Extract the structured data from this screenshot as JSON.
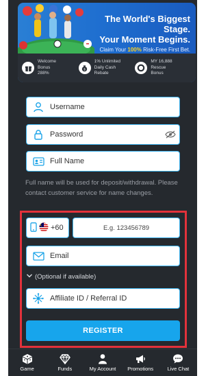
{
  "banner": {
    "title_line1": "The World's Biggest Stage.",
    "title_line2": "Your Moment Begins.",
    "subtitle_pre": "Claim Your ",
    "subtitle_highlight": "100%",
    "subtitle_post": " Risk-Free First Bet.",
    "perks": [
      {
        "icon": "gift-icon",
        "line1": "Welcome",
        "line2": "Bonus",
        "line3": "288%"
      },
      {
        "icon": "money-bag-icon",
        "line1": "1% Unlimited",
        "line2": "Daily Cash",
        "line3": "Rebate"
      },
      {
        "icon": "lifebuoy-icon",
        "line1": "MY 16,888",
        "line2": "Rescue",
        "line3": "Bonus"
      }
    ]
  },
  "form": {
    "username_placeholder": "Username",
    "password_placeholder": "Password",
    "fullname_placeholder": "Full Name",
    "fullname_note": "Full name will be used for deposit/withdrawal. Please contact customer service for name changes.",
    "country_code": "+60",
    "phone_placeholder": "E.g. 123456789",
    "email_placeholder": "Email",
    "optional_label": "(Optional if available)",
    "affiliate_placeholder": "Affiliate ID / Referral ID",
    "register_label": "REGISTER"
  },
  "nav": {
    "items": [
      {
        "label": "Game",
        "icon": "dice-icon"
      },
      {
        "label": "Funds",
        "icon": "diamond-icon"
      },
      {
        "label": "My Account",
        "icon": "user-icon"
      },
      {
        "label": "Promotions",
        "icon": "megaphone-icon"
      },
      {
        "label": "Live Chat",
        "icon": "chat-icon"
      }
    ]
  },
  "colors": {
    "background": "#25292e",
    "accent": "#17a5ec",
    "field_border": "#3fb6f2",
    "highlight_box": "#e3323b",
    "banner_blue": "#1f6fd0",
    "banner_yellow": "#ffd21f"
  }
}
